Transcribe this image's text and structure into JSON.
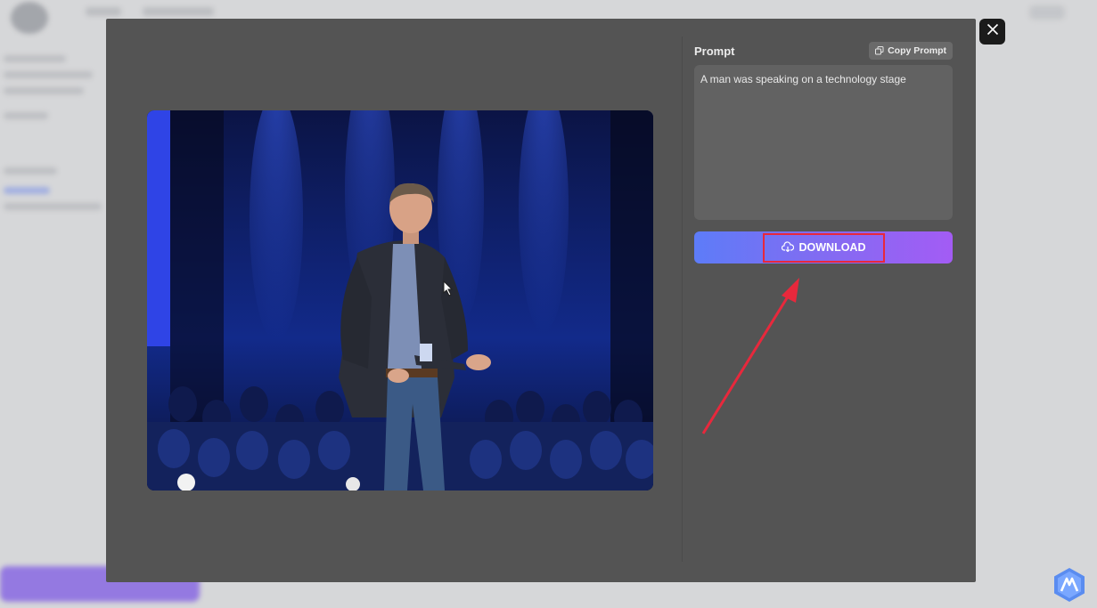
{
  "modal": {
    "prompt_label": "Prompt",
    "copy_prompt_label": "Copy Prompt",
    "prompt_text": "A man was speaking on a technology stage",
    "download_label": "DOWNLOAD"
  },
  "icons": {
    "copy": "copy-icon",
    "download": "cloud-download-icon",
    "close": "close-icon",
    "brand": "brand-logo-icon"
  },
  "colors": {
    "modal_bg": "#545454",
    "download_gradient_start": "#5d7cf8",
    "download_gradient_end": "#a35cf4",
    "annotation_red": "#e8283c"
  }
}
